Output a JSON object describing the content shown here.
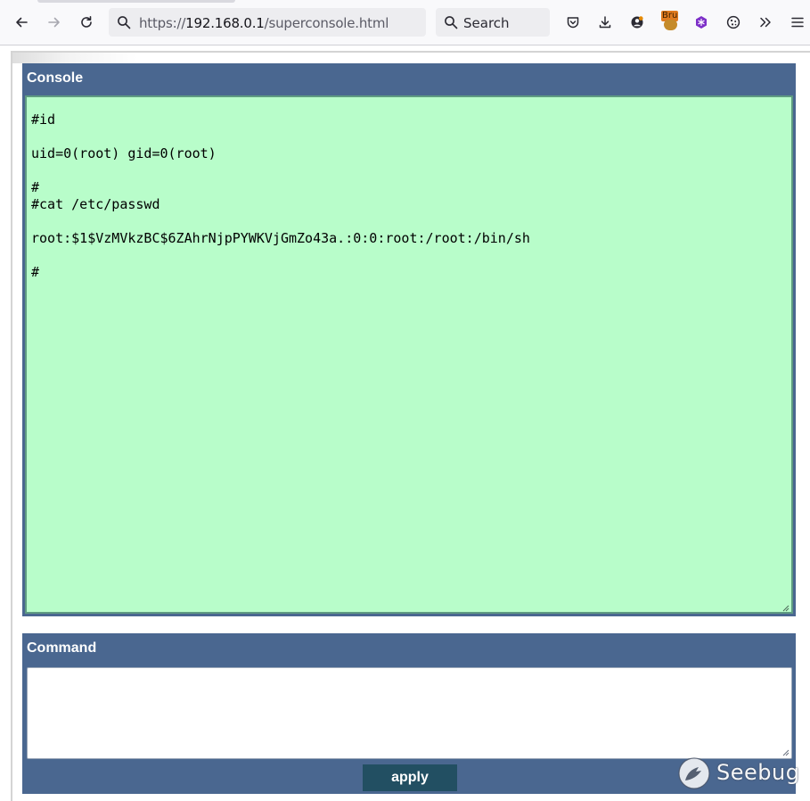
{
  "browser": {
    "url_prefix": "https://",
    "url_host": "192.168.0.1",
    "url_path": "/superconsole.html",
    "search_placeholder": "Search",
    "extension_badge_label": "Bru",
    "icons": {
      "back": "back-arrow-icon",
      "forward": "forward-arrow-icon",
      "reload": "reload-icon",
      "pocket": "pocket-icon",
      "downloads": "download-icon",
      "account": "account-icon",
      "bru_extension": "bru-extension-icon",
      "puzzle_extension": "purple-extension-icon",
      "cookie_extension": "cookie-icon",
      "overflow": "overflow-chevrons-icon",
      "menu": "hamburger-menu-icon"
    }
  },
  "console": {
    "title": "Console",
    "lines": [
      "#id",
      "",
      "uid=0(root) gid=0(root)",
      "",
      "#",
      "#cat /etc/passwd",
      "",
      "root:$1$VzMVkzBC$6ZAhrNjpPYWKVjGmZo43a.:0:0:root:/root:/bin/sh",
      "",
      "#"
    ]
  },
  "command": {
    "title": "Command",
    "input_value": "",
    "apply_label": "apply"
  },
  "watermark": {
    "text": "Seebug"
  },
  "colors": {
    "panel_header": "#4a6790",
    "console_bg": "#b8fdca",
    "apply_button": "#224f62"
  }
}
